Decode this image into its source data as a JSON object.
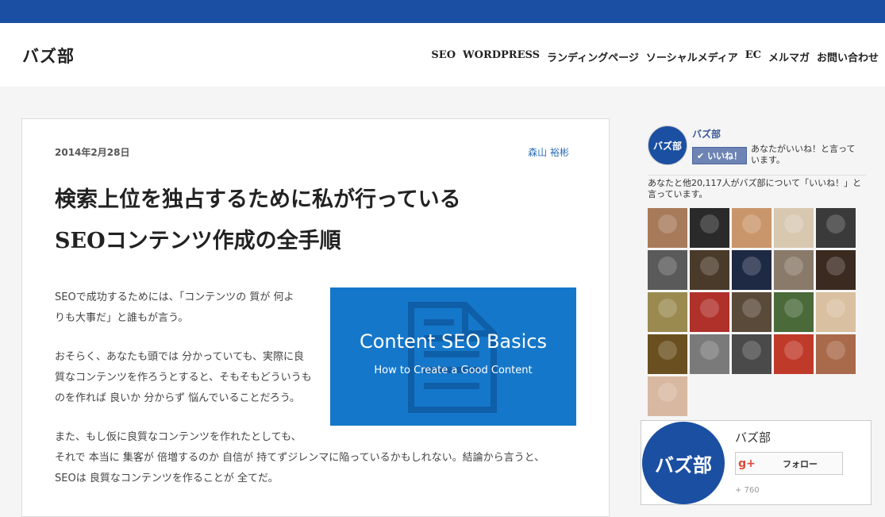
{
  "header": {
    "logo": "バズ部",
    "nav": [
      "SEO",
      "WORDPRESS",
      "ランディングページ",
      "ソーシャルメディア",
      "EC",
      "メルマガ",
      "お問い合わせ"
    ]
  },
  "article": {
    "date": "2014年2月28日",
    "author": "森山 裕彬",
    "title_line1": "検索上位を独占するために私が行っている",
    "title_line2": "SEOコンテンツ作成の全手順",
    "para1_line1": "SEOで成功するためには、「コンテンツの 質が 何よ",
    "para1_line2": "りも大事だ」と誰もが言う。",
    "para2_line1": "おそらく、あなたも頭では 分かっていても、実際に良",
    "para2_line2": "質なコンテンツを作ろうとすると、そもそもどういうも",
    "para2_line3": "のを作れば 良いか 分からず 悩んでいることだろう。",
    "para3_line1": "また、もし仮に良質なコンテンツを作れたとしても、",
    "para3_line2": "それで 本当に 集客が 倍増するのか 自信が 持てずジレンマに陥っているかもしれない。結論から言うと、",
    "para3_line3": "SEOは 良質なコンテンツを作ることが 全てだ。",
    "hero_title": "Content SEO Basics",
    "hero_subtitle": "How to Create a Good Content"
  },
  "facebook": {
    "page_name": "バズ部",
    "avatar_text": "バズ部",
    "like_label": "いいね！",
    "you_like": "あなたがいいね！と言って います。",
    "count_text": "あなたと他20,117人がバズ部について「いいね！」と言っています。",
    "face_colors": [
      "#a77a5a",
      "#2a2a2a",
      "#c9966b",
      "#d8c8b0",
      "#3a3a3a",
      "#5a5a5a",
      "#4a3a2a",
      "#1e2a44",
      "#8a7a6a",
      "#3a2a20",
      "#9a8a50",
      "#b0302a",
      "#5a4a3a",
      "#4a6a3a",
      "#d8c0a0",
      "#6a5020",
      "#7a7a7a",
      "#4a4a4a",
      "#c03a2a",
      "#a86a4a",
      "#d8b8a0"
    ]
  },
  "gplus": {
    "name": "バズ部",
    "logo_text": "バズ部",
    "icon": "g+",
    "follow_label": "フォロー",
    "count": "+ 760"
  }
}
